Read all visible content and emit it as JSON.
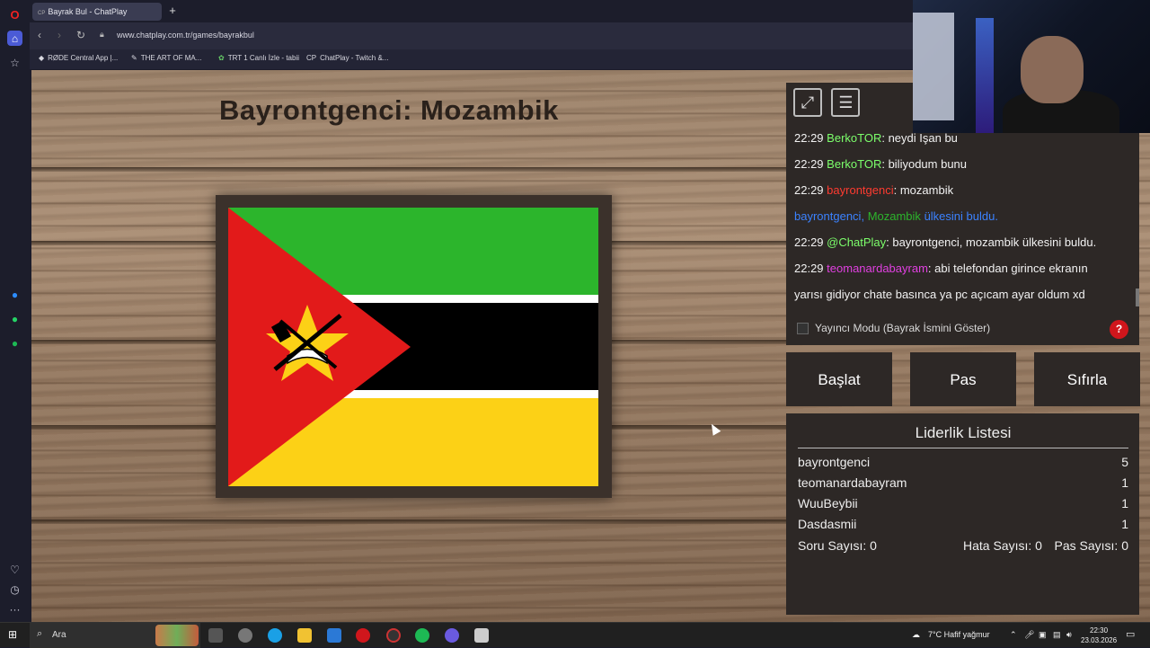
{
  "browser": {
    "tab_title": "Bayrak Bul - ChatPlay",
    "tab_prefix": "CP",
    "new_tab": "+",
    "url": "www.chatplay.com.tr/games/bayrakbul",
    "bookmarks": [
      "RØDE Central App |...",
      "THE ART OF MA...",
      "TRT 1 Canlı İzle - tabii",
      "ChatPlay - Twitch &..."
    ]
  },
  "game": {
    "title": "Bayrontgenci: Mozambik"
  },
  "chat": {
    "lines": [
      {
        "time": "22:29",
        "user": "BerkoTOR",
        "user_color": "#7cff6b",
        "text": ": neydi Işan bu"
      },
      {
        "time": "22:29",
        "user": "BerkoTOR",
        "user_color": "#7cff6b",
        "text": ": biliyodum bunu"
      },
      {
        "time": "22:29",
        "user": "bayrontgenci",
        "user_color": "#ff3b30",
        "text": ": mozambik"
      }
    ],
    "announce": {
      "user": "bayrontgenci,",
      "country": "Mozambik",
      "rest": "ülkesini buldu."
    },
    "bot_line": {
      "time": "22:29",
      "user": "@ChatPlay",
      "text": ": bayrontgenci, mozambik ülkesini buldu."
    },
    "last_line": {
      "time": "22:29",
      "user": "teomanardabayram",
      "text": ": abi telefondan girince ekranın",
      "text2": "yarısı gidiyor chate basınca ya pc açıcam ayar oldum xd"
    }
  },
  "mode": {
    "label": "Yayıncı Modu (Bayrak İsmini Göster)",
    "help": "?"
  },
  "buttons": {
    "start": "Başlat",
    "pass": "Pas",
    "reset": "Sıfırla"
  },
  "leaderboard": {
    "title": "Liderlik Listesi",
    "rows": [
      {
        "name": "bayrontgenci",
        "score": "5"
      },
      {
        "name": "teomanardabayram",
        "score": "1"
      },
      {
        "name": "WuuBeybii",
        "score": "1"
      },
      {
        "name": "Dasdasmii",
        "score": "1"
      }
    ],
    "questions": "Soru Sayısı: 0",
    "errors": "Hata Sayısı: 0",
    "passes": "Pas Sayısı: 0"
  },
  "taskbar": {
    "search_placeholder": "Ara",
    "weather": "7°C  Hafif yağmur",
    "time": "22:30",
    "date": "23.03.2026"
  },
  "colors": {
    "chat_bg": "#2d2826",
    "flag_green": "#2cb52c",
    "flag_black": "#000000",
    "flag_yellow": "#fcd116",
    "flag_red": "#e21a1a"
  }
}
